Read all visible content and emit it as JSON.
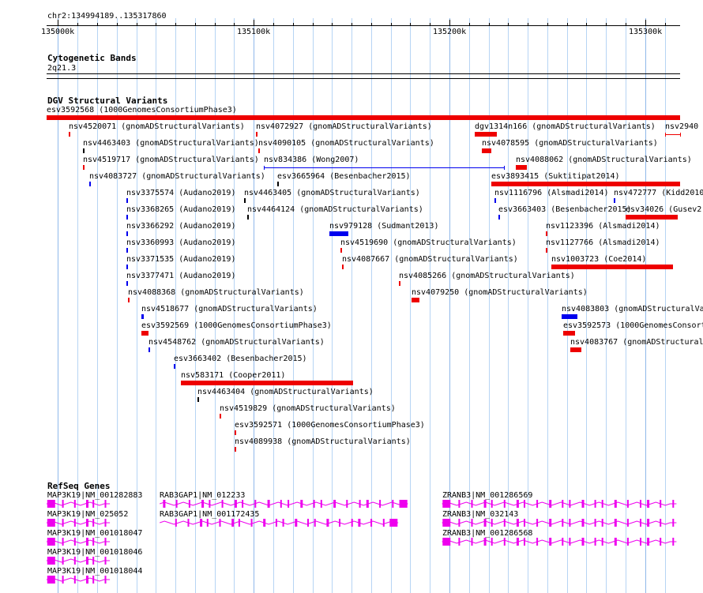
{
  "view": {
    "location": "chr2:134994189..135317860",
    "start": 134994189,
    "end": 135317860
  },
  "ruler": {
    "ticks": [
      {
        "label": "135000k",
        "pos": 135000000
      },
      {
        "label": "135100k",
        "pos": 135100000
      },
      {
        "label": "135200k",
        "pos": 135200000
      },
      {
        "label": "135300k",
        "pos": 135300000
      }
    ]
  },
  "cytobands": {
    "title": "Cytogenetic Bands",
    "band": "2q21.3"
  },
  "dgv": {
    "title": "DGV Structural Variants",
    "colors": {
      "red": "#ee0000",
      "blue": "#0000ee",
      "black": "#000000"
    }
  },
  "refseq": {
    "title": "RefSeq Genes",
    "color": "#ee00ee"
  },
  "features": [
    {
      "label": "esv3592568 (1000GenomesConsortiumPhase3)",
      "row": 0,
      "start": 134994189,
      "end": 135317860,
      "color": "red",
      "h": 6
    },
    {
      "label": "nsv4520071 (gnomADStructuralVariants)",
      "row": 1,
      "start": 135005500,
      "end": 135006200,
      "color": "red",
      "h": 6
    },
    {
      "label": "nsv4072927 (gnomADStructuralVariants)",
      "row": 1,
      "start": 135101200,
      "end": 135102000,
      "color": "red",
      "h": 6
    },
    {
      "label": "dgv1314n166 (gnomADStructuralVariants)",
      "row": 1,
      "start": 135212800,
      "end": 135224000,
      "color": "red",
      "h": 6
    },
    {
      "label": "nsv2940 (K",
      "row": 1,
      "start": 135310000,
      "end": 135317860,
      "color": "red",
      "h": 1,
      "trunc": true
    },
    {
      "label": "nsv4463403 (gnomADStructuralVariants)",
      "row": 2,
      "start": 135012800,
      "end": 135013300,
      "color": "black",
      "h": 6
    },
    {
      "label": "nsv4090105 (gnomADStructuralVariants)",
      "row": 2,
      "start": 135102500,
      "end": 135103300,
      "color": "red",
      "h": 6
    },
    {
      "label": "nsv4078595 (gnomADStructuralVariants)",
      "row": 2,
      "start": 135216500,
      "end": 135221500,
      "color": "red",
      "h": 6
    },
    {
      "label": "nsv4519717 (gnomADStructuralVariants)",
      "row": 3,
      "start": 135012800,
      "end": 135013400,
      "color": "red",
      "h": 6
    },
    {
      "label": "nsv834386 (Wong2007)",
      "row": 3,
      "start": 135105000,
      "end": 135228000,
      "color": "blue",
      "h": 1
    },
    {
      "label": "nsv4088062 (gnomADStructuralVariants)",
      "row": 3,
      "start": 135234000,
      "end": 135239500,
      "color": "red",
      "h": 6
    },
    {
      "label": "nsv4083727 (gnomADStructuralVariants)",
      "row": 4,
      "start": 135015900,
      "end": 135016600,
      "color": "blue",
      "h": 6
    },
    {
      "label": "esv3665964 (Besenbacher2015)",
      "row": 4,
      "start": 135112200,
      "end": 135113000,
      "color": "black",
      "h": 6
    },
    {
      "label": "esv3893415 (Suktitipat2014)",
      "row": 4,
      "start": 135221500,
      "end": 135317860,
      "color": "red",
      "h": 6
    },
    {
      "label": "nsv3375574 (Audano2019)",
      "row": 5,
      "start": 135034800,
      "end": 135035500,
      "color": "blue",
      "h": 6
    },
    {
      "label": "nsv4463405 (gnomADStructuralVariants)",
      "row": 5,
      "start": 135095100,
      "end": 135095800,
      "color": "black",
      "h": 6
    },
    {
      "label": "nsv1116796 (Alsmadi2014)",
      "row": 5,
      "start": 135223200,
      "end": 135224000,
      "color": "blue",
      "h": 6
    },
    {
      "label": "nsv472777 (Kidd2010)",
      "row": 5,
      "start": 135283900,
      "end": 135284700,
      "color": "blue",
      "h": 6
    },
    {
      "label": "nsv3368265 (Audano2019)",
      "row": 6,
      "start": 135034800,
      "end": 135035500,
      "color": "blue",
      "h": 6
    },
    {
      "label": "nsv4464124 (gnomADStructuralVariants)",
      "row": 6,
      "start": 135096600,
      "end": 135097300,
      "color": "black",
      "h": 6
    },
    {
      "label": "esv3663403 (Besenbacher2015)",
      "row": 6,
      "start": 135225100,
      "end": 135225900,
      "color": "blue",
      "h": 6
    },
    {
      "label": "esv34026 (Gusev2",
      "row": 6,
      "start": 135290000,
      "end": 135316500,
      "color": "red",
      "h": 6,
      "trunc": true
    },
    {
      "label": "nsv3366292 (Audano2019)",
      "row": 7,
      "start": 135034800,
      "end": 135035500,
      "color": "blue",
      "h": 6
    },
    {
      "label": "nsv979128 (Sudmant2013)",
      "row": 7,
      "start": 135138500,
      "end": 135148000,
      "color": "blue",
      "h": 6
    },
    {
      "label": "nsv1123396 (Alsmadi2014)",
      "row": 7,
      "start": 135249400,
      "end": 135250200,
      "color": "red",
      "h": 6
    },
    {
      "label": "nsv3360993 (Audano2019)",
      "row": 8,
      "start": 135034800,
      "end": 135035500,
      "color": "blue",
      "h": 6
    },
    {
      "label": "nsv4519690 (gnomADStructuralVariants)",
      "row": 8,
      "start": 135144500,
      "end": 135145300,
      "color": "red",
      "h": 6
    },
    {
      "label": "nsv1127766 (Alsmadi2014)",
      "row": 8,
      "start": 135249400,
      "end": 135250200,
      "color": "red",
      "h": 6
    },
    {
      "label": "nsv3371535 (Audano2019)",
      "row": 9,
      "start": 135034800,
      "end": 135035500,
      "color": "blue",
      "h": 6
    },
    {
      "label": "nsv4087667 (gnomADStructuralVariants)",
      "row": 9,
      "start": 135145000,
      "end": 135145800,
      "color": "red",
      "h": 6
    },
    {
      "label": "nsv1003723 (Coe2014)",
      "row": 9,
      "start": 135252000,
      "end": 135314000,
      "color": "red",
      "h": 6
    },
    {
      "label": "nsv3377471 (Audano2019)",
      "row": 10,
      "start": 135034800,
      "end": 135035500,
      "color": "blue",
      "h": 6
    },
    {
      "label": "nsv4085266 (gnomADStructuralVariants)",
      "row": 10,
      "start": 135174100,
      "end": 135174900,
      "color": "red",
      "h": 6
    },
    {
      "label": "nsv4088368 (gnomADStructuralVariants)",
      "row": 11,
      "start": 135035900,
      "end": 135036700,
      "color": "red",
      "h": 6
    },
    {
      "label": "nsv4079250 (gnomADStructuralVariants)",
      "row": 11,
      "start": 135180600,
      "end": 135184700,
      "color": "red",
      "h": 6
    },
    {
      "label": "nsv4518677 (gnomADStructuralVariants)",
      "row": 12,
      "start": 135042600,
      "end": 135043700,
      "color": "blue",
      "h": 6
    },
    {
      "label": "nsv4083803 (gnomADStructuralVari",
      "row": 12,
      "start": 135257400,
      "end": 135265500,
      "color": "blue",
      "h": 6,
      "trunc": true
    },
    {
      "label": "esv3592569 (1000GenomesConsortiumPhase3)",
      "row": 13,
      "start": 135042600,
      "end": 135046300,
      "color": "red",
      "h": 6
    },
    {
      "label": "esv3592573 (1000GenomesConsortiu",
      "row": 13,
      "start": 135258300,
      "end": 135264400,
      "color": "red",
      "h": 6,
      "trunc": true
    },
    {
      "label": "nsv4548762 (gnomADStructuralVariants)",
      "row": 14,
      "start": 135046300,
      "end": 135047100,
      "color": "blue",
      "h": 6
    },
    {
      "label": "nsv4083767 (gnomADStructuralVa",
      "row": 14,
      "start": 135261900,
      "end": 135267600,
      "color": "red",
      "h": 6,
      "trunc": true
    },
    {
      "label": "esv3663402 (Besenbacher2015)",
      "row": 15,
      "start": 135059300,
      "end": 135060100,
      "color": "blue",
      "h": 6
    },
    {
      "label": "nsv583171 (Cooper2011)",
      "row": 16,
      "start": 135062900,
      "end": 135151000,
      "color": "red",
      "h": 6
    },
    {
      "label": "nsv4463404 (gnomADStructuralVariants)",
      "row": 17,
      "start": 135071100,
      "end": 135071900,
      "color": "black",
      "h": 6
    },
    {
      "label": "nsv4519829 (gnomADStructuralVariants)",
      "row": 18,
      "start": 135082500,
      "end": 135083300,
      "color": "red",
      "h": 6
    },
    {
      "label": "esv3592571 (1000GenomesConsortiumPhase3)",
      "row": 19,
      "start": 135090300,
      "end": 135091100,
      "color": "red",
      "h": 6
    },
    {
      "label": "nsv4089938 (gnomADStructuralVariants)",
      "row": 20,
      "start": 135090300,
      "end": 135091100,
      "color": "red",
      "h": 6
    }
  ],
  "genes": [
    {
      "label": "MAP3K19|NM_001282883",
      "row": 0,
      "start": 134994500,
      "end": 135026500,
      "dir": "left"
    },
    {
      "label": "RAB3GAP1|NM_012233",
      "row": 0,
      "start": 135052000,
      "end": 135178500,
      "dir": "right"
    },
    {
      "label": "ZRANB3|NM_001286569",
      "row": 0,
      "start": 135196500,
      "end": 135316000,
      "dir": "left"
    },
    {
      "label": "MAP3K19|NM_025052",
      "row": 1,
      "start": 134994500,
      "end": 135026500,
      "dir": "left"
    },
    {
      "label": "RAB3GAP1|NM_001172435",
      "row": 1,
      "start": 135052000,
      "end": 135173500,
      "dir": "right"
    },
    {
      "label": "ZRANB3|NM_032143",
      "row": 1,
      "start": 135196500,
      "end": 135316000,
      "dir": "left"
    },
    {
      "label": "MAP3K19|NM_001018047",
      "row": 2,
      "start": 134994500,
      "end": 135026500,
      "dir": "left"
    },
    {
      "label": "ZRANB3|NM_001286568",
      "row": 2,
      "start": 135196500,
      "end": 135316000,
      "dir": "left"
    },
    {
      "label": "MAP3K19|NM_001018046",
      "row": 3,
      "start": 134994500,
      "end": 135026500,
      "dir": "left"
    },
    {
      "label": "MAP3K19|NM_001018044",
      "row": 4,
      "start": 134994500,
      "end": 135026500,
      "dir": "left"
    }
  ]
}
